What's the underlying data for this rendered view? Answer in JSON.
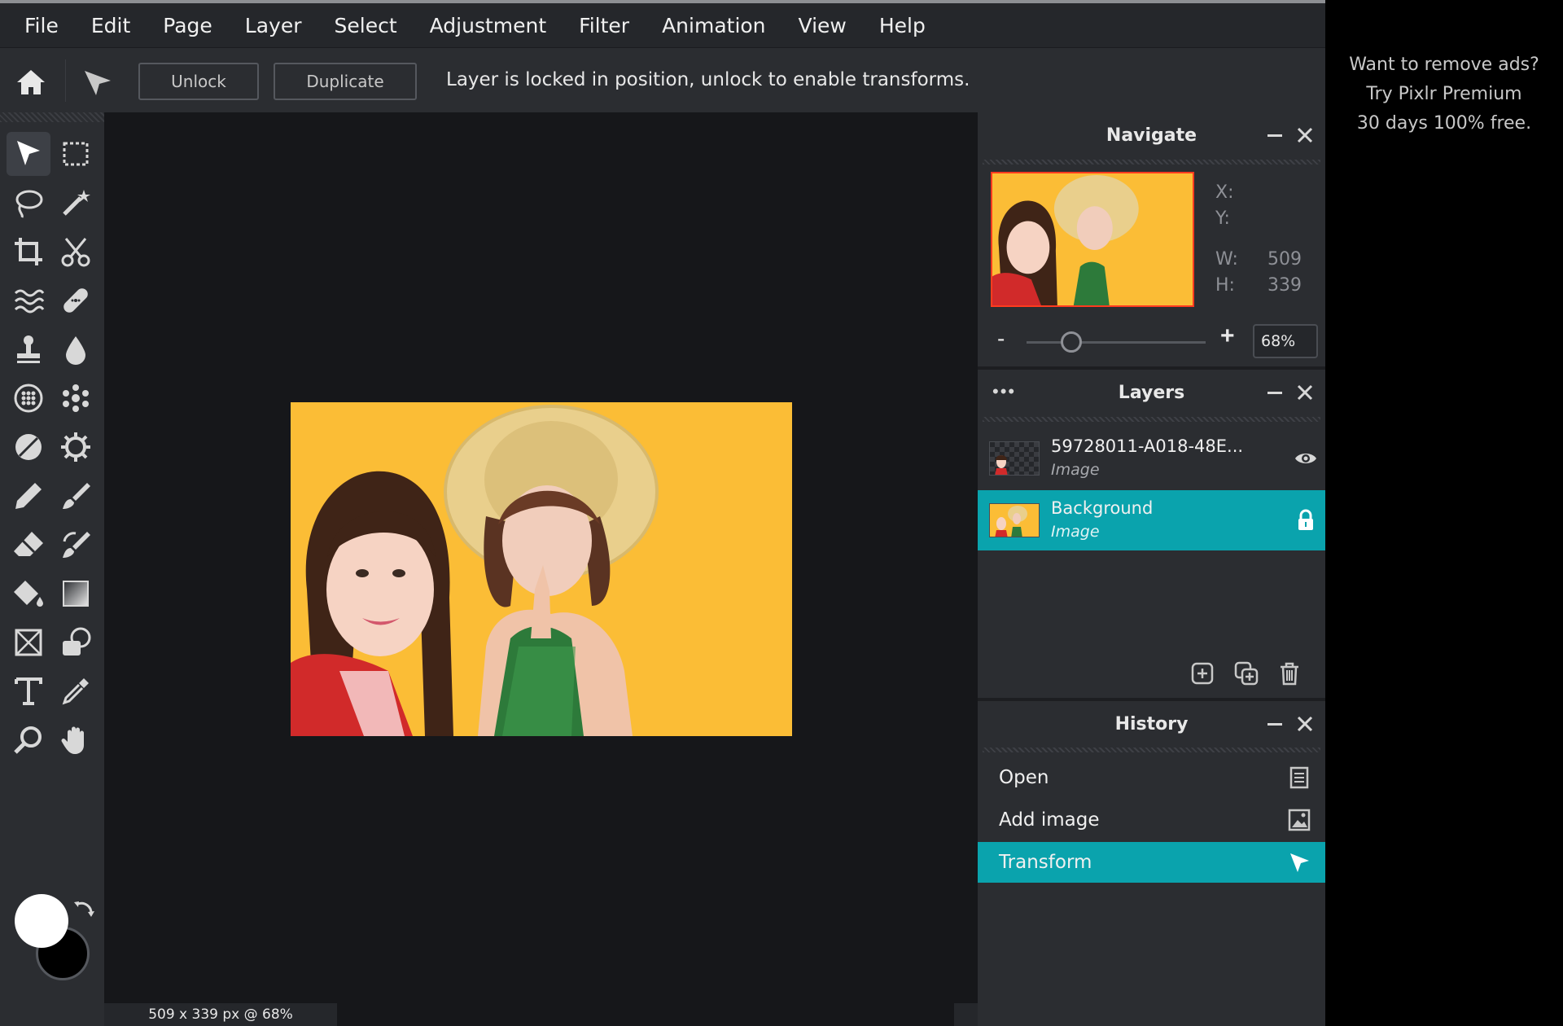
{
  "menu": [
    "File",
    "Edit",
    "Page",
    "Layer",
    "Select",
    "Adjustment",
    "Filter",
    "Animation",
    "View",
    "Help"
  ],
  "options": {
    "unlock_label": "Unlock",
    "duplicate_label": "Duplicate",
    "message": "Layer is locked in position, unlock to enable transforms."
  },
  "tools": [
    "arrange-tool-icon",
    "marquee-select-icon",
    "lasso-select-icon",
    "magic-wand-icon",
    "crop-tool-icon",
    "cutout-scissors-icon",
    "liquify-tool-icon",
    "heal-tool-icon",
    "clone-stamp-icon",
    "blur-drop-icon",
    "sponge-tool-icon",
    "spot-pattern-icon",
    "dodge-burn-icon",
    "color-replace-icon",
    "pencil-tool-icon",
    "brush-tool-icon",
    "eraser-tool-icon",
    "smudge-tool-icon",
    "paint-bucket-icon",
    "gradient-tool-icon",
    "frame-tool-icon",
    "shape-tool-icon",
    "text-tool-icon",
    "color-picker-icon",
    "zoom-tool-icon",
    "hand-tool-icon"
  ],
  "colors": {
    "foreground": "#ffffff",
    "background": "#000000",
    "accent": "#0aa3ad",
    "canvas_bg": "#fbbd36"
  },
  "status": {
    "text": "509 x 339 px @ 68%"
  },
  "navigate": {
    "title": "Navigate",
    "x_label": "X:",
    "y_label": "Y:",
    "w_label": "W:",
    "w_value": "509",
    "h_label": "H:",
    "h_value": "339",
    "zoom_value": "68%",
    "zoom_minus": "-",
    "zoom_plus": "+",
    "zoom_level": 0.25
  },
  "layers": {
    "title": "Layers",
    "menu_dots": "•••",
    "items": [
      {
        "name": "59728011-A018-48E...",
        "type": "Image",
        "state_icon": "eye-icon",
        "selected": false
      },
      {
        "name": "Background",
        "type": "Image",
        "state_icon": "lock-icon",
        "selected": true
      }
    ]
  },
  "history": {
    "title": "History",
    "items": [
      {
        "label": "Open",
        "icon": "document-icon",
        "selected": false
      },
      {
        "label": "Add image",
        "icon": "image-icon",
        "selected": false
      },
      {
        "label": "Transform",
        "icon": "arrow-cursor-icon",
        "selected": true
      }
    ]
  },
  "ad": {
    "line1": "Want to remove ads?",
    "line2": "Try Pixlr Premium",
    "line3": "30 days 100% free."
  }
}
